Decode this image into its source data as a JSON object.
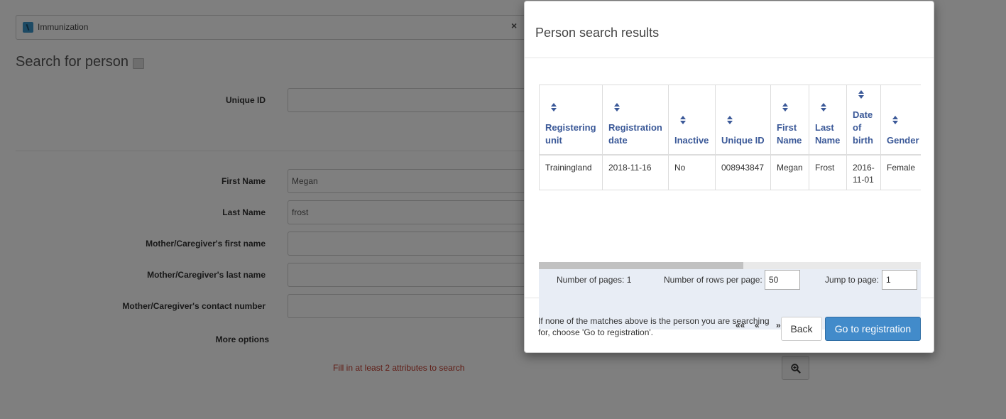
{
  "program": {
    "name": "Immunization",
    "close_symbol": "×"
  },
  "search": {
    "title": "Search for person",
    "fields": [
      {
        "label": "Unique ID",
        "value": ""
      },
      {
        "label": "First Name",
        "value": "Megan"
      },
      {
        "label": "Last Name",
        "value": "frost"
      },
      {
        "label": "Mother/Caregiver's first name",
        "value": ""
      },
      {
        "label": "Mother/Caregiver's last name",
        "value": ""
      },
      {
        "label": "Mother/Caregiver's contact number",
        "value": ""
      }
    ],
    "more_options": "More options",
    "hint": "Fill in at least 2 attributes to search"
  },
  "modal": {
    "title": "Person search results",
    "table": {
      "columns": [
        {
          "lines": [
            "Registering",
            "unit"
          ]
        },
        {
          "lines": [
            "Registration",
            "date"
          ]
        },
        {
          "lines": [
            "Inactive"
          ]
        },
        {
          "lines": [
            "Unique ID"
          ]
        },
        {
          "lines": [
            "First",
            "Name"
          ]
        },
        {
          "lines": [
            "Last",
            "Name"
          ]
        },
        {
          "lines": [
            "Date",
            "of",
            "birth"
          ]
        },
        {
          "lines": [
            "Gender"
          ]
        }
      ],
      "rows": [
        [
          "Trainingland",
          "2018-11-16",
          "No",
          "008943847",
          "Megan",
          "Frost",
          "2016-11-01",
          "Female"
        ]
      ]
    },
    "pager": {
      "pages_text": "Number of pages: 1",
      "rows_label": "Number of rows per page:",
      "rows_value": "50",
      "jump_label": "Jump to page:",
      "jump_value": "1",
      "first": "««",
      "prev": "«",
      "next": "»",
      "last": "»»"
    },
    "footer": {
      "note": "If none of the matches above is the person you are searching for, choose 'Go to registration'.",
      "back_label": "Back",
      "register_label": "Go to registration"
    }
  }
}
